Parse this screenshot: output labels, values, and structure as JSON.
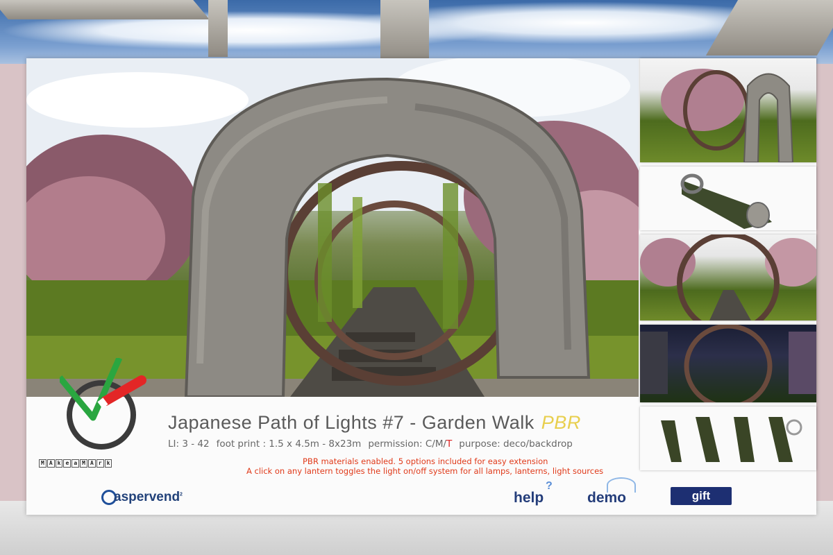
{
  "product": {
    "title": "Japanese Path of Lights #7 - Garden Walk",
    "title_badge": "PBR",
    "specs": {
      "li": "LI: 3 - 42",
      "footprint": "foot print : 1.5 x 4.5m - 8x23m",
      "permission_label": "permission: C/M/",
      "permission_t": "T",
      "purpose": "purpose: deco/backdrop"
    },
    "notes": [
      "PBR materials enabled. 5 options included for easy extension",
      "A click on any lantern toggles the light on/off system for all lamps, lanterns, light sources"
    ]
  },
  "brand": {
    "letters": [
      "M",
      "A",
      "k",
      "e",
      "a",
      "M",
      "A",
      "r",
      "k"
    ],
    "casper_text": "aspervend",
    "casper_sup": "2"
  },
  "buttons": {
    "help": "help",
    "help_mark": "?",
    "demo": "demo",
    "gift": "gift"
  },
  "colors": {
    "title": "#5a5a5a",
    "pbr_badge": "#e8cf4e",
    "notes": "#e03a1a",
    "gift_bg": "#1d2f72",
    "wall": "#d9c3c6"
  },
  "icons": [
    "checkmark-logo-icon",
    "casper-logo-icon",
    "help-icon",
    "demo-icon"
  ]
}
